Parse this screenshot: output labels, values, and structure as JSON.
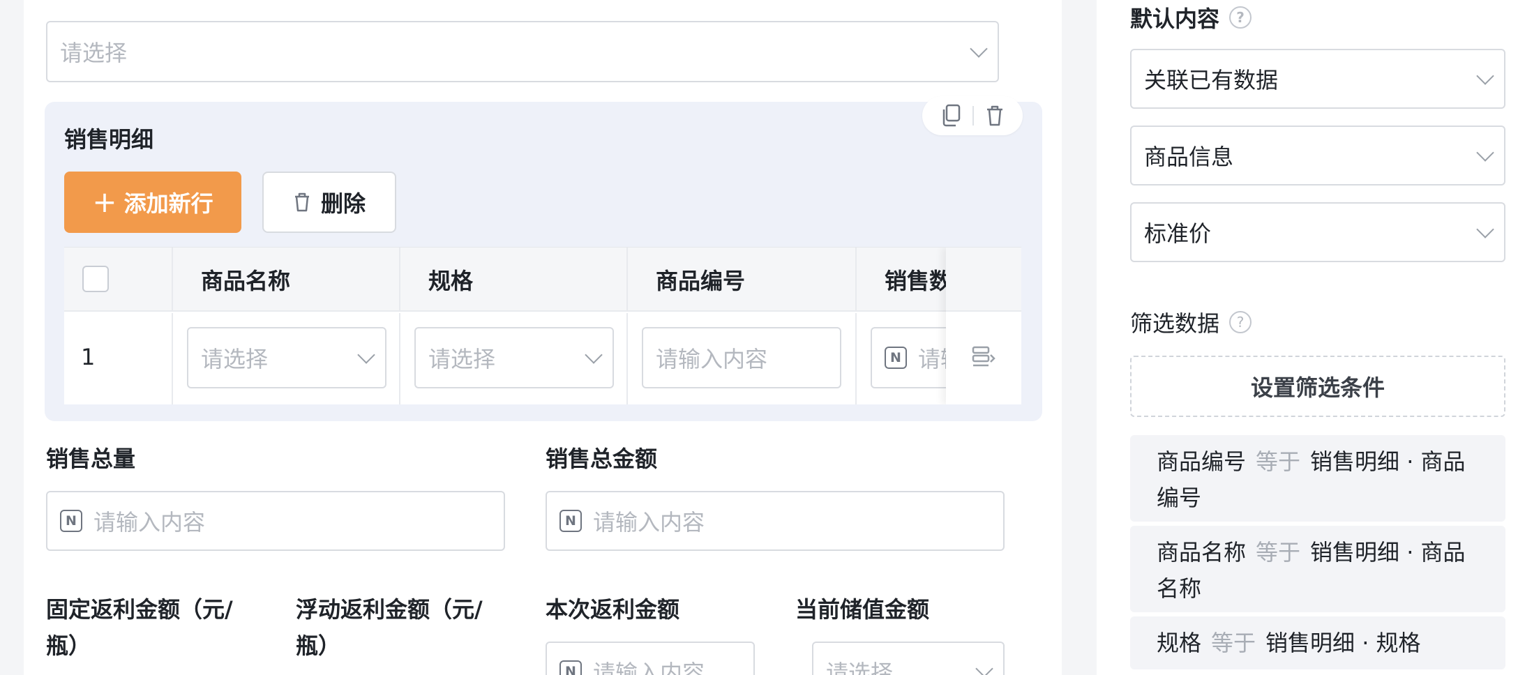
{
  "form": {
    "top_select_placeholder": "请选择",
    "subtable": {
      "title": "销售明细",
      "add_row_label": "添加新行",
      "delete_label": "删除",
      "columns": [
        "商品名称",
        "规格",
        "商品编号",
        "销售数"
      ],
      "row": {
        "index": "1",
        "name_placeholder": "请选择",
        "spec_placeholder": "请选择",
        "code_placeholder": "请输入内容",
        "qty_placeholder": "请输"
      }
    },
    "total_qty": {
      "label": "销售总量",
      "placeholder": "请输入内容"
    },
    "total_amount": {
      "label": "销售总金额",
      "placeholder": "请输入内容"
    },
    "fixed_rebate": {
      "label": "固定返利金额（元/瓶）"
    },
    "float_rebate": {
      "label": "浮动返利金额（元/瓶）"
    },
    "current_rebate": {
      "label": "本次返利金额",
      "placeholder": "请输入内容"
    },
    "stored_value": {
      "label": "当前储值金额",
      "placeholder": "请选择"
    }
  },
  "right_panel": {
    "default_content_label": "默认内容",
    "help_glyph": "?",
    "selects": [
      "关联已有数据",
      "商品信息",
      "标准价"
    ],
    "filter_label": "筛选数据",
    "set_filter_button": "设置筛选条件",
    "conditions": [
      {
        "field": "商品编号",
        "op": "等于",
        "value": "销售明细 · 商品编号"
      },
      {
        "field": "商品名称",
        "op": "等于",
        "value": "销售明细 · 商品名称"
      },
      {
        "field": "规格",
        "op": "等于",
        "value": "销售明细 · 规格"
      }
    ]
  },
  "colors": {
    "primary": "#f29a4b",
    "block_bg": "#eef1f9",
    "border": "#d8dbe0",
    "placeholder": "#b4b8bf"
  }
}
